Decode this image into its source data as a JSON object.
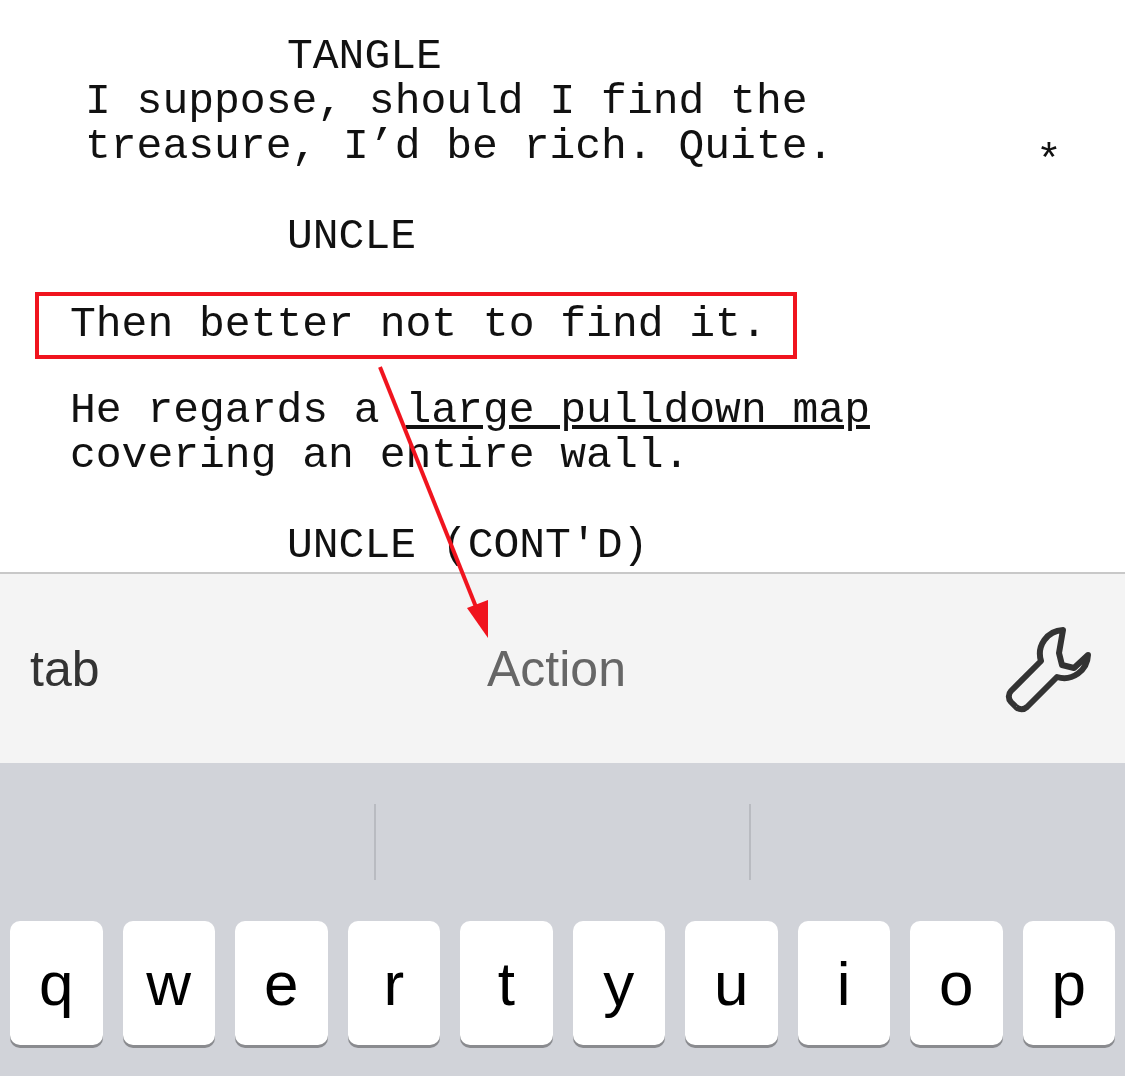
{
  "script": [
    {
      "kind": "character",
      "lines": [
        "TANGLE"
      ]
    },
    {
      "kind": "dialogue",
      "lines": [
        "I suppose, should I find the",
        "treasure, I’d be rich. Quite."
      ],
      "revision_mark": "*",
      "highlighted": false
    },
    {
      "kind": "character",
      "lines": [
        "UNCLE"
      ]
    },
    {
      "kind": "dialogue",
      "lines": [
        "Then better not to find it."
      ],
      "highlighted": true
    },
    {
      "kind": "action",
      "segments": [
        {
          "text": "He regards a ",
          "underline": false
        },
        {
          "text": "large pulldown map",
          "underline": true
        },
        {
          "text": "\ncovering an entire wall.",
          "underline": false
        }
      ]
    },
    {
      "kind": "character",
      "lines": [
        "UNCLE (CONT'D)"
      ]
    }
  ],
  "toolbar": {
    "tab_key": "tab",
    "element_type": "Action"
  },
  "keyboard": {
    "keys": [
      "q",
      "w",
      "e",
      "r",
      "t",
      "y",
      "u",
      "i",
      "o",
      "p"
    ]
  }
}
